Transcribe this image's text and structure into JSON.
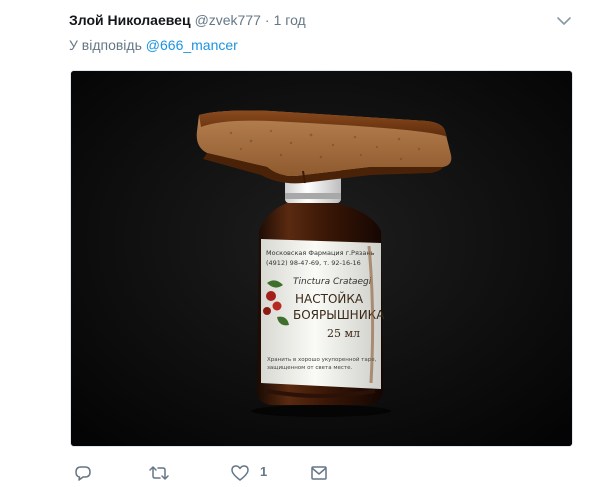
{
  "tweet": {
    "author_name": "Злой Николаевец",
    "author_handle": "@zvek777",
    "separator": "·",
    "timestamp": "1 год",
    "reply_prefix": "У відповідь",
    "reply_to": "@666_mancer"
  },
  "media": {
    "bottle_label": {
      "line1": "Московская Фармация г.Рязань",
      "line2": "(4912) 98-47-69, т. 92-16-16",
      "latin": "Tinctura Crataegi",
      "name1": "НАСТОЙКА",
      "name2": "БОЯРЫШНИКА",
      "volume": "25 мл",
      "storage1": "Хранить в хорошо укупоренной таре,",
      "storage2": "защищенном от света месте."
    }
  },
  "actions": {
    "reply_icon": "reply-icon",
    "retweet_icon": "retweet-icon",
    "like_icon": "heart-icon",
    "like_count": "1",
    "dm_icon": "envelope-icon"
  },
  "colors": {
    "text": "#14171a",
    "muted": "#657786",
    "link": "#1b95e0"
  }
}
